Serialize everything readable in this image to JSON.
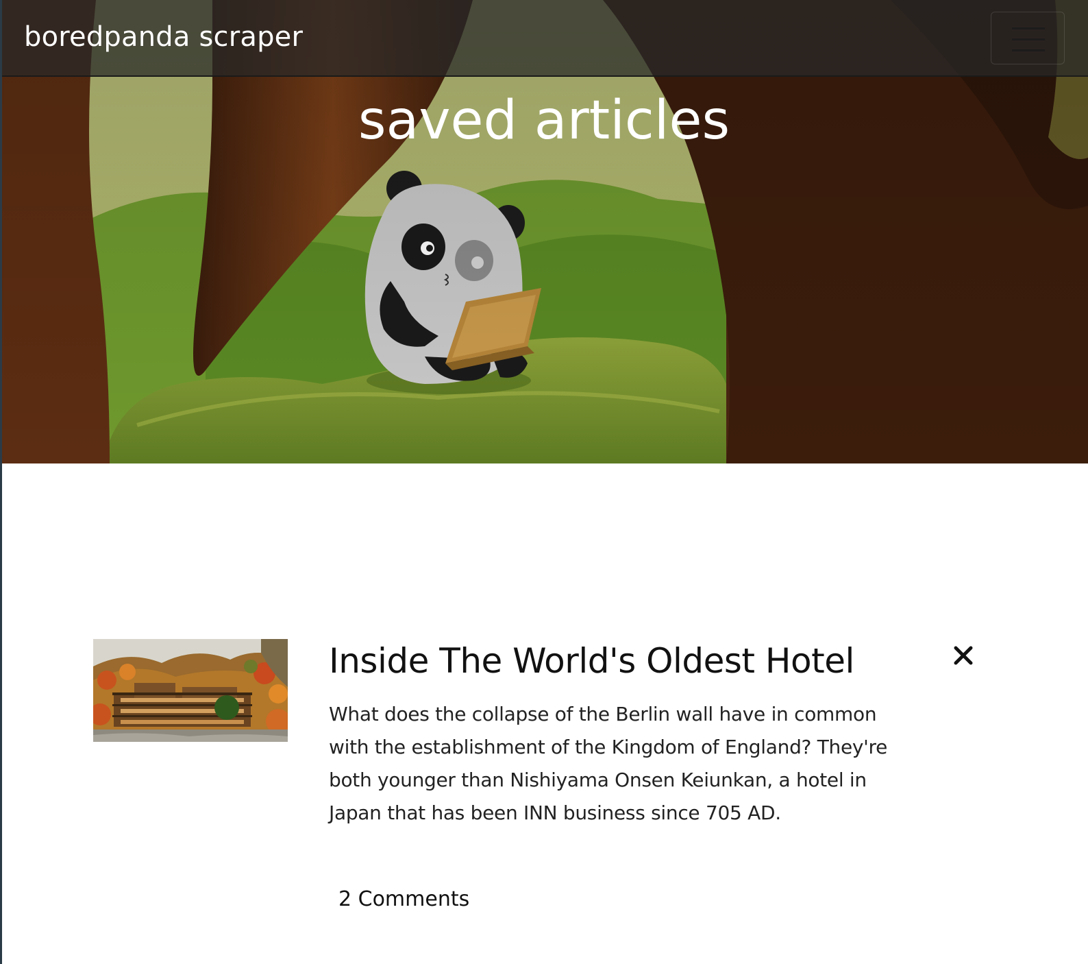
{
  "navbar": {
    "brand": "boredpanda scraper",
    "toggle_icon": "hamburger-menu-icon"
  },
  "hero": {
    "title": "saved articles",
    "illustration": "panda-with-laptop-in-forest"
  },
  "articles": [
    {
      "title": "Inside The World's Oldest Hotel",
      "summary": "What does the collapse of the Berlin wall have in common with the establishment of the Kingdom of England? They're both younger than Nishiyama Onsen Keiunkan, a hotel in Japan that has been INN business since 705 AD.",
      "comments": "2 Comments",
      "thumbnail": "hotel-autumn-mountains-photo",
      "delete_icon": "close-icon"
    }
  ],
  "colors": {
    "navbar_bg": "#282828",
    "hero_title": "#ffffff",
    "text": "#111111"
  }
}
